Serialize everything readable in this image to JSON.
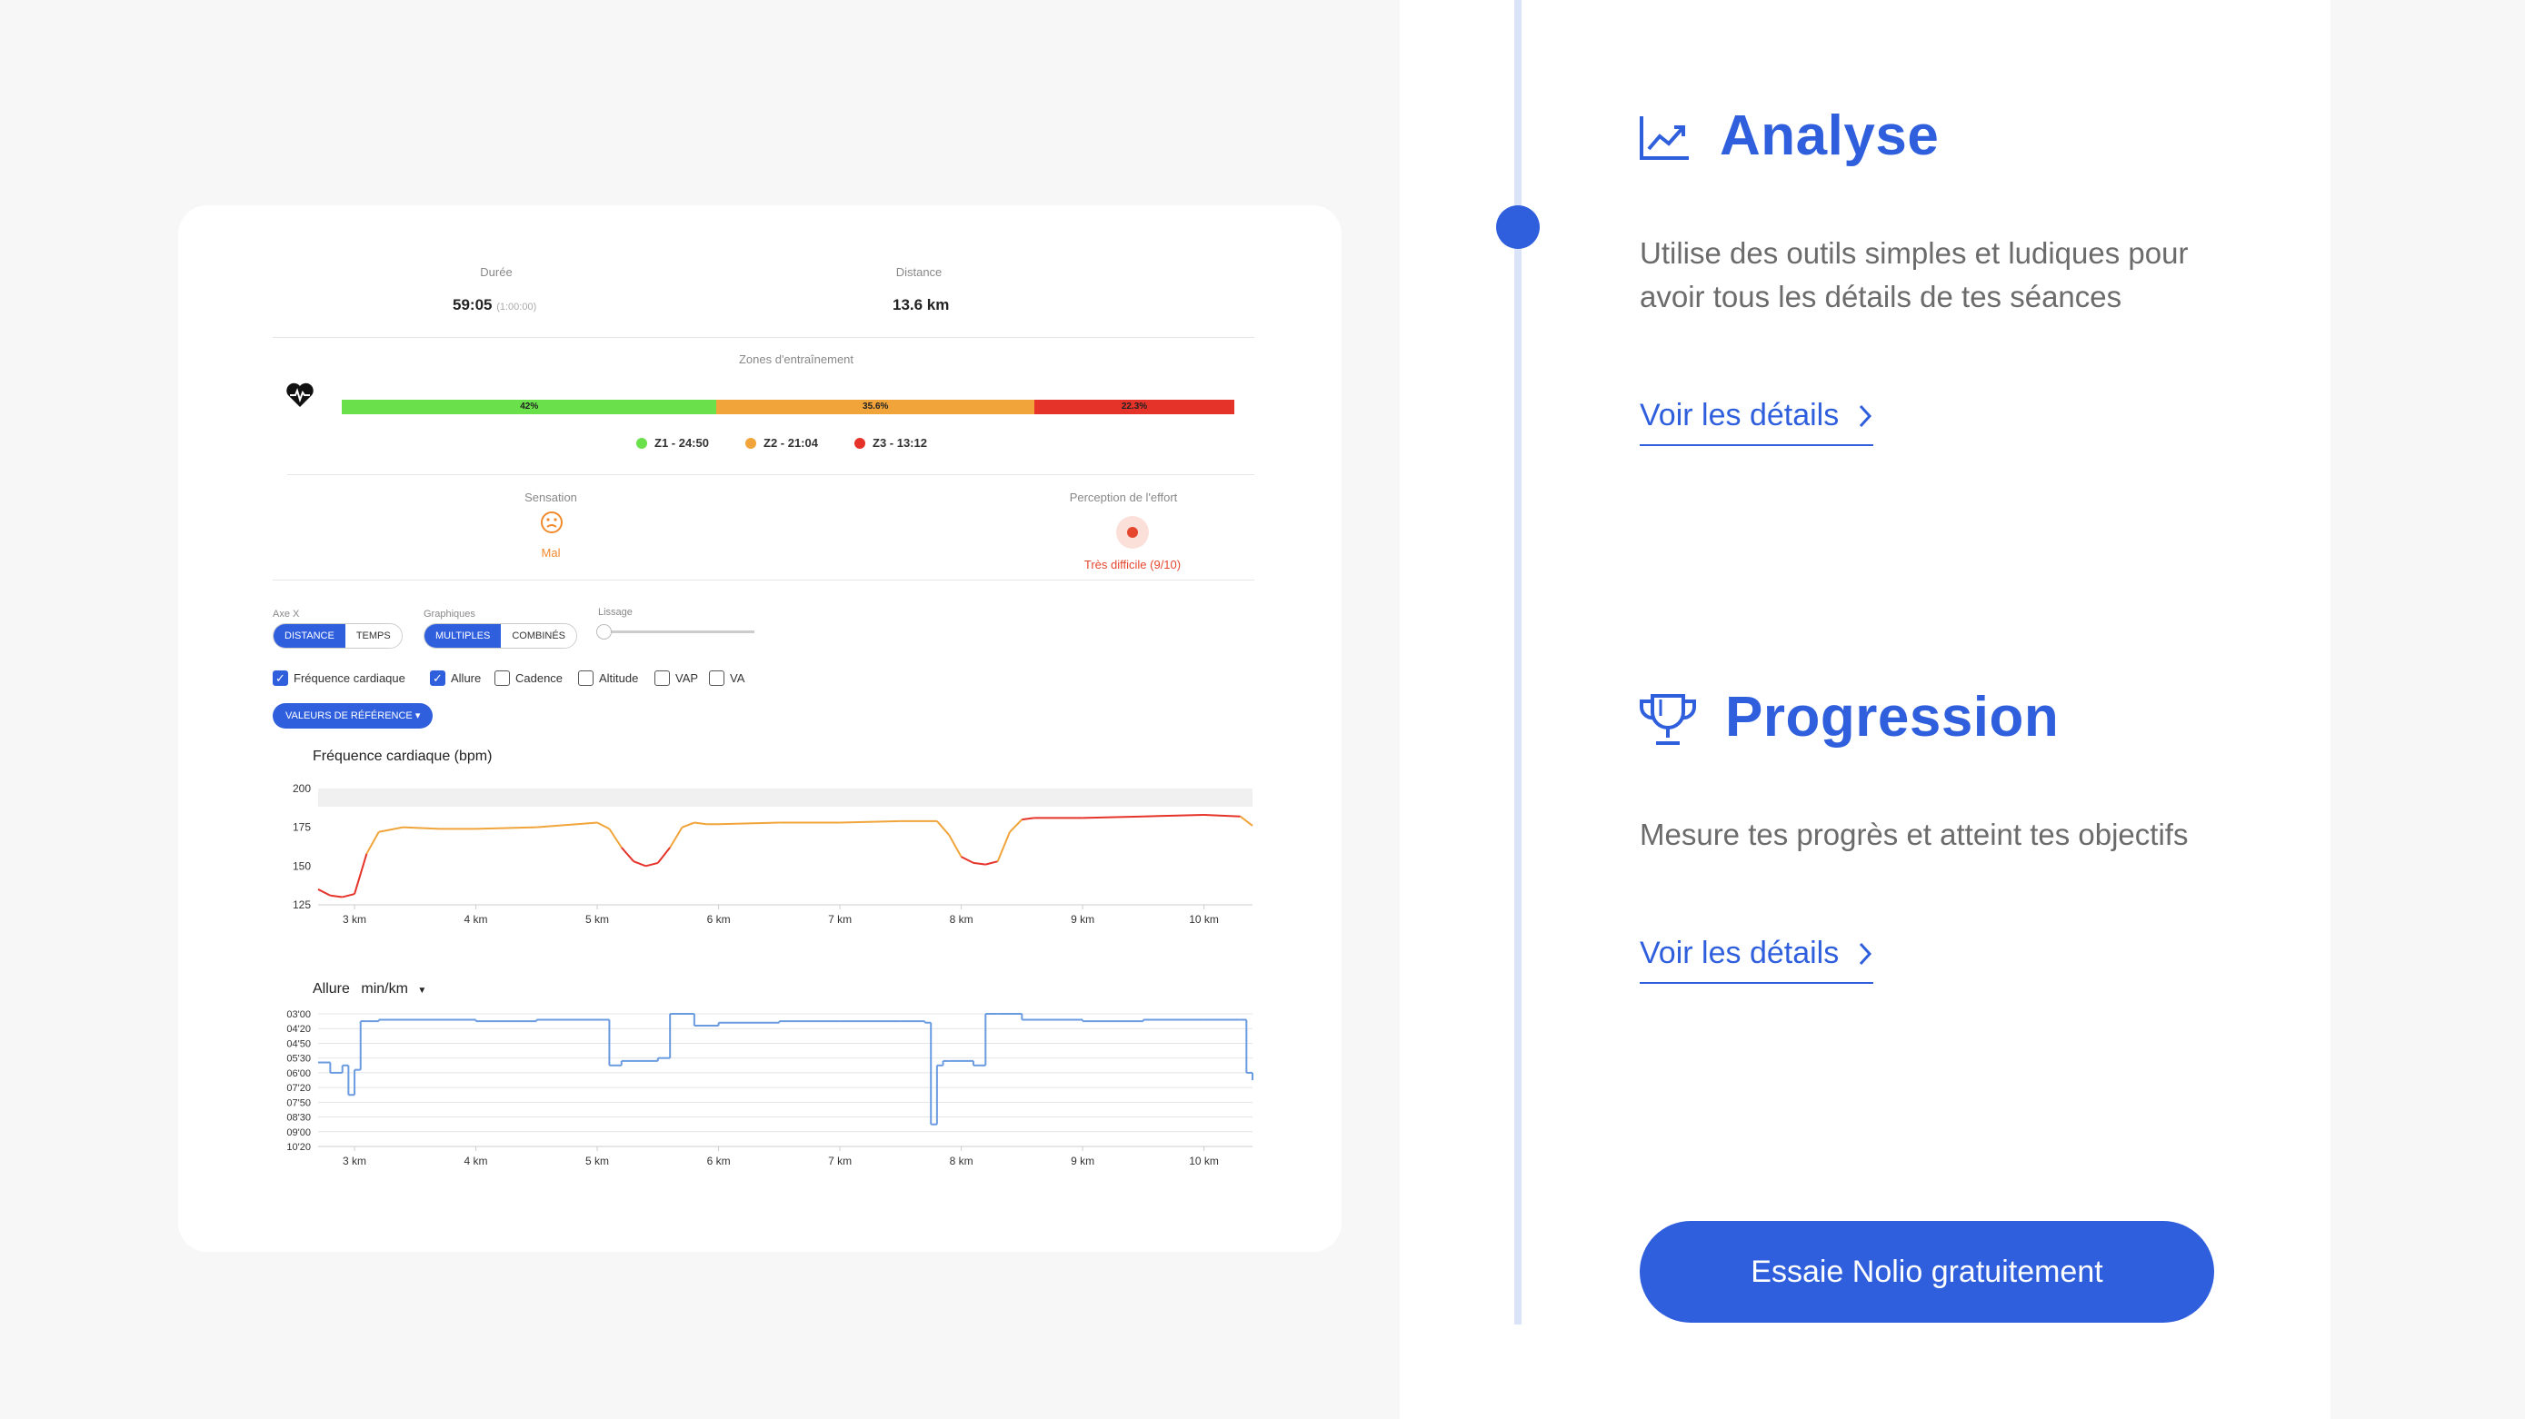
{
  "session": {
    "duration_label": "Durée",
    "duration_value": "59:05",
    "duration_planned": "(1:00:00)",
    "distance_label": "Distance",
    "distance_value": "13.6 km"
  },
  "zones": {
    "title": "Zones d'entraînement",
    "bars": [
      {
        "label": "42%",
        "fraction": 0.42,
        "color": "#6ae14a"
      },
      {
        "label": "35.6%",
        "fraction": 0.356,
        "color": "#f0a43a"
      },
      {
        "label": "22.3%",
        "fraction": 0.223,
        "color": "#e5332a"
      }
    ],
    "legend": [
      {
        "text": "Z1 - 24:50",
        "color": "#6ae14a"
      },
      {
        "text": "Z2 - 21:04",
        "color": "#f0a43a"
      },
      {
        "text": "Z3 - 13:12",
        "color": "#e5332a"
      }
    ]
  },
  "feeling": {
    "label": "Sensation",
    "value": "Mal",
    "effort_label": "Perception de l'effort",
    "effort_value": "Très difficile (9/10)"
  },
  "controls": {
    "axis_label": "Axe X",
    "axis_options": [
      "DISTANCE",
      "TEMPS"
    ],
    "graph_label": "Graphiques",
    "graph_options": [
      "MULTIPLES",
      "COMBINÉS"
    ],
    "smoothing_label": "Lissage",
    "checkboxes": [
      {
        "label": "Fréquence cardiaque",
        "checked": true
      },
      {
        "label": "Allure",
        "checked": true
      },
      {
        "label": "Cadence",
        "checked": false
      },
      {
        "label": "Altitude",
        "checked": false
      },
      {
        "label": "VAP",
        "checked": false
      },
      {
        "label": "VA",
        "checked": false
      }
    ],
    "reference_button": "VALEURS DE RÉFÉRENCE"
  },
  "chart_data": [
    {
      "type": "line",
      "title": "Fréquence cardiaque (bpm)",
      "x_ticks": [
        "3 km",
        "4 km",
        "5 km",
        "6 km",
        "7 km",
        "8 km",
        "9 km",
        "10 km"
      ],
      "y_ticks": [
        "200",
        "175",
        "150",
        "125"
      ],
      "ylim": [
        125,
        200
      ],
      "xlim": [
        2.7,
        10.4
      ],
      "x": [
        2.7,
        2.8,
        2.9,
        3.0,
        3.1,
        3.2,
        3.4,
        3.7,
        4.0,
        4.5,
        5.0,
        5.1,
        5.2,
        5.3,
        5.4,
        5.5,
        5.6,
        5.7,
        5.8,
        5.9,
        6.0,
        6.5,
        7.0,
        7.5,
        7.8,
        7.9,
        8.0,
        8.1,
        8.2,
        8.3,
        8.4,
        8.5,
        8.6,
        9.0,
        9.5,
        10.0,
        10.3,
        10.4
      ],
      "y": [
        135,
        131,
        130,
        132,
        158,
        172,
        175,
        174,
        174,
        175,
        178,
        174,
        162,
        153,
        150,
        152,
        162,
        175,
        178,
        177,
        177,
        178,
        178,
        179,
        179,
        170,
        156,
        152,
        151,
        153,
        172,
        180,
        181,
        181,
        182,
        183,
        182,
        176
      ]
    },
    {
      "type": "line",
      "title": "Allure",
      "unit_label": "min/km",
      "x_ticks": [
        "3 km",
        "4 km",
        "5 km",
        "6 km",
        "7 km",
        "8 km",
        "9 km",
        "10 km"
      ],
      "y_ticks": [
        "03'00",
        "04'20",
        "04'50",
        "05'30",
        "06'00",
        "07'20",
        "07'50",
        "08'30",
        "09'00",
        "10'20"
      ],
      "ylim": [
        0,
        9
      ],
      "xlim": [
        2.7,
        10.4
      ],
      "x": [
        2.7,
        2.8,
        2.9,
        2.95,
        3.0,
        3.05,
        3.1,
        3.2,
        3.4,
        4.0,
        4.5,
        5.0,
        5.1,
        5.2,
        5.5,
        5.6,
        5.7,
        5.8,
        6.0,
        6.5,
        7.0,
        7.5,
        7.7,
        7.75,
        7.8,
        7.85,
        7.9,
        8.1,
        8.2,
        8.3,
        8.5,
        9.0,
        9.5,
        10.0,
        10.3,
        10.35,
        10.4
      ],
      "y": [
        3.3,
        4.0,
        3.5,
        5.5,
        3.8,
        0.5,
        0.5,
        0.4,
        0.4,
        0.5,
        0.4,
        0.4,
        3.5,
        3.2,
        3.0,
        0.0,
        0.0,
        0.8,
        0.6,
        0.5,
        0.5,
        0.5,
        0.6,
        7.5,
        3.5,
        3.2,
        3.2,
        3.5,
        0.0,
        0.0,
        0.4,
        0.5,
        0.4,
        0.4,
        0.4,
        4.0,
        4.5
      ]
    }
  ],
  "sections": [
    {
      "title": "Analyse",
      "icon": "trending-up-icon",
      "description": "Utilise des outils simples et ludiques pour avoir tous les détails de tes séances",
      "link": "Voir les détails"
    },
    {
      "title": "Progression",
      "icon": "trophy-icon",
      "description": "Mesure tes progrès et atteint tes objectifs",
      "link": "Voir les détails"
    }
  ],
  "cta": {
    "label": "Essaie Nolio gratuitement"
  },
  "colors": {
    "accent": "#2f5fdc",
    "hr_line": "#e0493a",
    "pace_line": "#6a9be0"
  }
}
